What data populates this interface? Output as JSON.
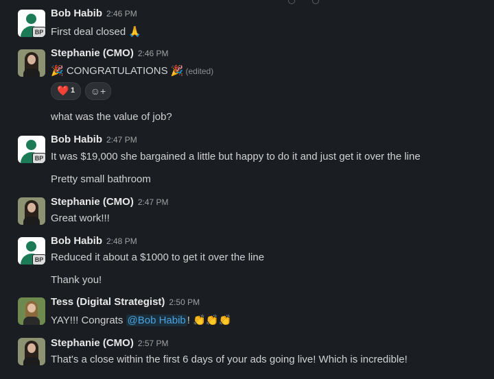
{
  "messages": [
    {
      "author": "Bob Habib",
      "time": "2:46 PM",
      "lines": [
        "First deal closed 🙏"
      ]
    },
    {
      "author": "Stephanie (CMO)",
      "time": "2:46 PM",
      "lines": [
        "🎉 CONGRATULATIONS 🎉",
        "what was the value of job?"
      ],
      "edited": "(edited)",
      "reaction": {
        "emoji": "❤️",
        "count": "1"
      }
    },
    {
      "author": "Bob Habib",
      "time": "2:47 PM",
      "lines": [
        "It was $19,000 she bargained a little but happy to do it and just get it over the line",
        "Pretty small bathroom"
      ]
    },
    {
      "author": "Stephanie (CMO)",
      "time": "2:47 PM",
      "lines": [
        "Great work!!!"
      ]
    },
    {
      "author": "Bob Habib",
      "time": "2:48 PM",
      "lines": [
        "Reduced it about a $1000 to get it over the line",
        "Thank you!"
      ]
    },
    {
      "author": "Tess (Digital Strategist)",
      "time": "2:50 PM",
      "text_prefix": "YAY!!! Congrats ",
      "mention": "@Bob Habib",
      "text_suffix": "! 👏👏👏"
    },
    {
      "author": "Stephanie (CMO)",
      "time": "2:57 PM",
      "lines": [
        "That's a close within the first 6 days of your ads going live! Which is incredible!"
      ]
    }
  ],
  "avatar_badge": "BP",
  "icons": {
    "add_reaction": "add-emoji-icon",
    "heart": "heart-icon"
  }
}
